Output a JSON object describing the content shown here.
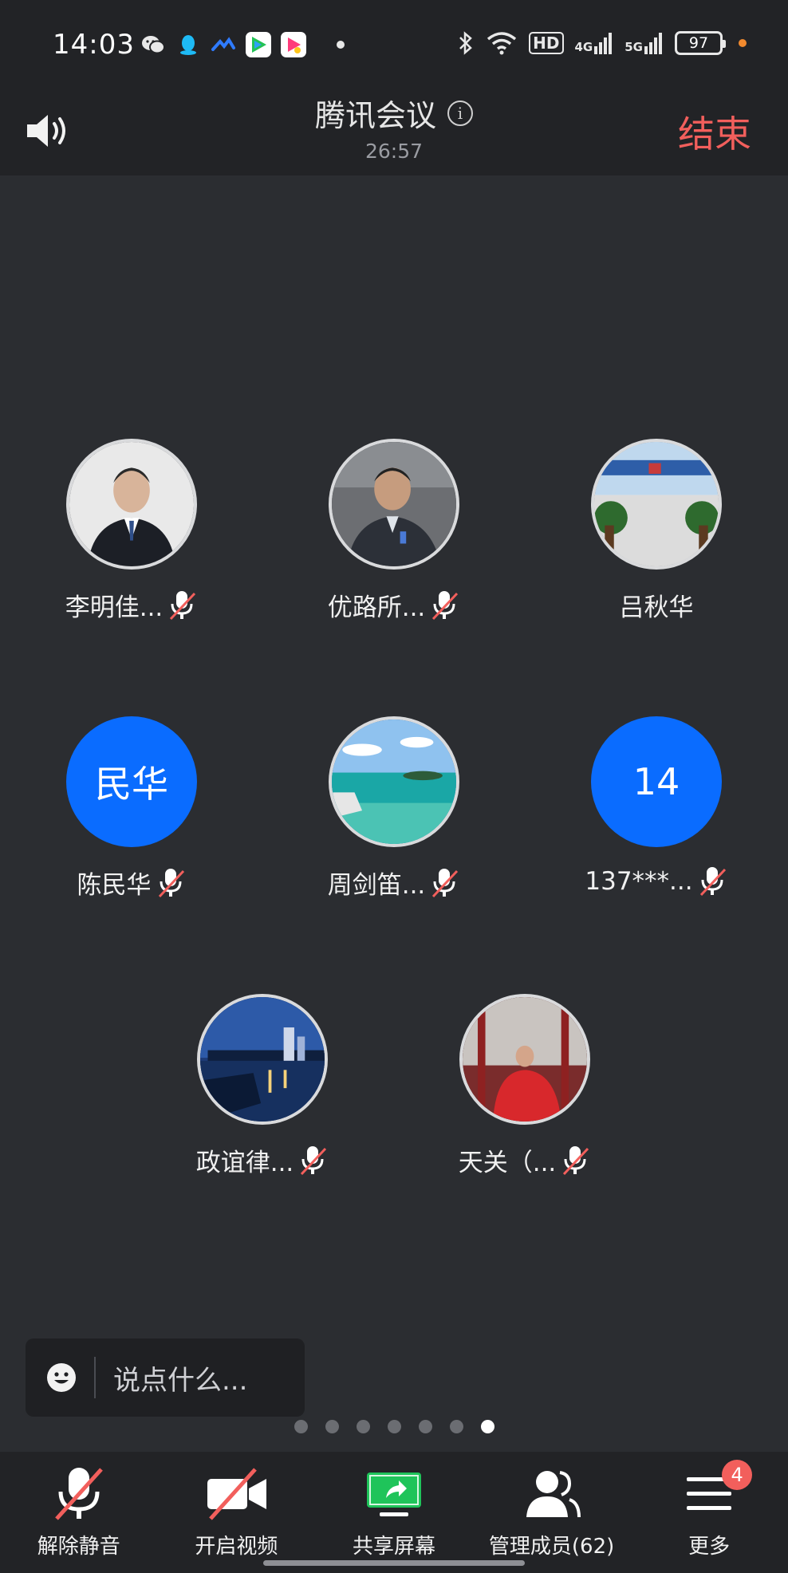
{
  "status_bar": {
    "time": "14:03",
    "apps": [
      "wechat-icon",
      "qq-icon",
      "feishu-icon",
      "tencent-video-icon",
      "mango-tv-icon"
    ],
    "signal_labels": [
      "HD",
      "4G",
      "5G"
    ],
    "battery": "97"
  },
  "header": {
    "title": "腾讯会议",
    "timer": "26:57",
    "end_label": "结束"
  },
  "participants": [
    {
      "name": "李明佳...",
      "muted": true,
      "avatar": "photo-man-suit"
    },
    {
      "name": "优路所...",
      "muted": true,
      "avatar": "photo-man-desk"
    },
    {
      "name": "吕秋华",
      "muted": false,
      "avatar": "photo-office-sign"
    },
    {
      "name": "陈民华",
      "muted": true,
      "avatar_text": "民华"
    },
    {
      "name": "周剑笛...",
      "muted": true,
      "avatar": "photo-sea"
    },
    {
      "name": "137***...",
      "muted": true,
      "avatar_text": "14"
    },
    {
      "name": "政谊律...",
      "muted": true,
      "avatar": "photo-city-night"
    },
    {
      "name": "天关（...",
      "muted": true,
      "avatar": "photo-ferris-wheel"
    }
  ],
  "chat": {
    "placeholder": "说点什么..."
  },
  "pagination": {
    "count": 7,
    "active": 7
  },
  "toolbar": {
    "unmute_label": "解除静音",
    "video_label": "开启视频",
    "share_label": "共享屏幕",
    "members_label": "管理成员(62)",
    "more_label": "更多",
    "more_badge": "4"
  },
  "colors": {
    "accent": "#0a6cff",
    "end": "#f25f5c",
    "share": "#1fc45a",
    "background": "#2b2d31"
  }
}
